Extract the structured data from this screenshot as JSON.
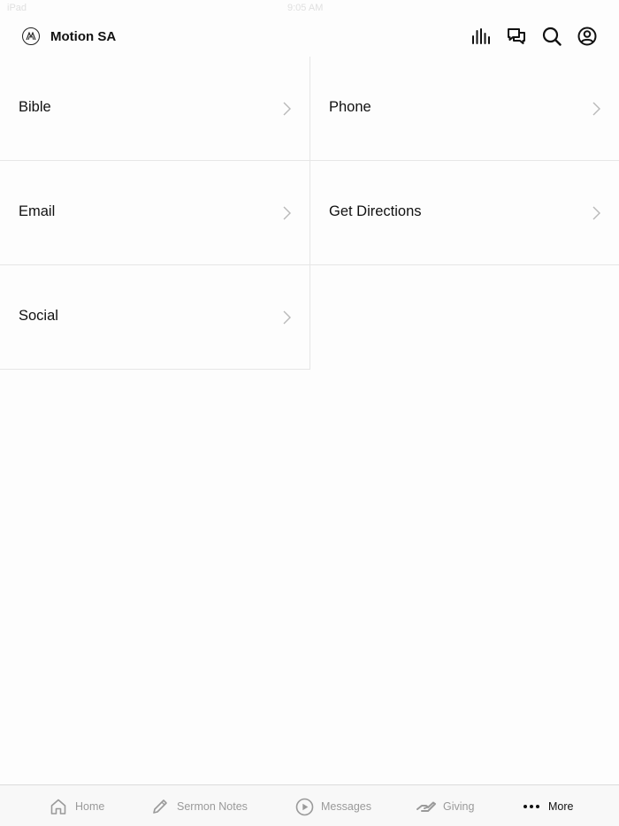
{
  "status": {
    "left": "iPad",
    "time": "9:05 AM"
  },
  "header": {
    "app_name": "Motion SA",
    "icons": [
      "audio-bars-icon",
      "chat-icon",
      "search-icon",
      "profile-icon"
    ]
  },
  "menu": {
    "items": [
      {
        "label": "Bible"
      },
      {
        "label": "Phone"
      },
      {
        "label": "Email"
      },
      {
        "label": "Get Directions"
      },
      {
        "label": "Social"
      }
    ]
  },
  "tabs": [
    {
      "label": "Home",
      "icon": "home-icon"
    },
    {
      "label": "Sermon Notes",
      "icon": "pencil-icon"
    },
    {
      "label": "Messages",
      "icon": "play-circle-icon"
    },
    {
      "label": "Giving",
      "icon": "giving-hand-icon"
    },
    {
      "label": "More",
      "icon": "more-dots-icon",
      "active": true
    }
  ],
  "colors": {
    "text": "#111111",
    "muted": "#9a9a9a",
    "divider": "#e6e6e6",
    "chevron": "#b8b8b8"
  }
}
